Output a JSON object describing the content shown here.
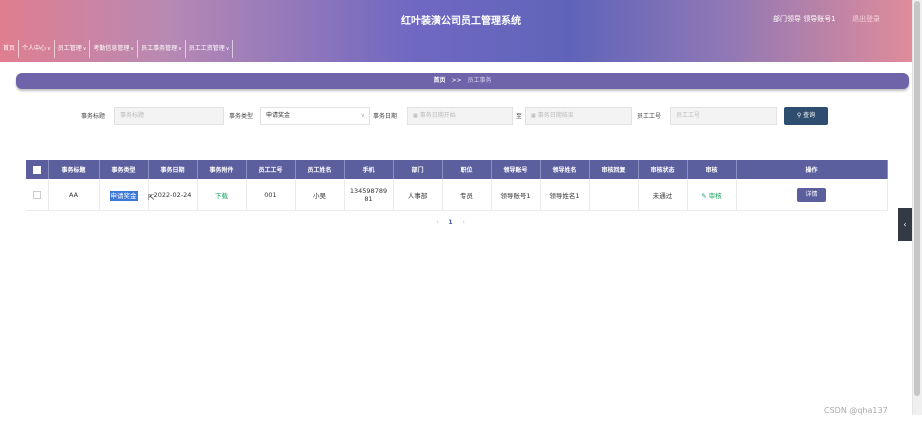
{
  "header": {
    "title": "红叶装潢公司员工管理系统",
    "user_info": "部门领导 领导账号1",
    "logout": "退出登录"
  },
  "nav": {
    "items": [
      {
        "label": "首页",
        "has_dropdown": false
      },
      {
        "label": "个人中心",
        "has_dropdown": true
      },
      {
        "label": "员工管理",
        "has_dropdown": true
      },
      {
        "label": "考勤信息管理",
        "has_dropdown": true
      },
      {
        "label": "员工事务管理",
        "has_dropdown": true
      },
      {
        "label": "员工工资管理",
        "has_dropdown": true
      }
    ]
  },
  "breadcrumb": {
    "home": "首页",
    "separator": ">>",
    "current": "员工事务"
  },
  "search": {
    "title_label": "事务标题",
    "title_placeholder": "事务标题",
    "type_label": "事务类型",
    "type_value": "申请奖金",
    "date_label": "事务日期",
    "date_start_placeholder": "事务日期开始",
    "date_to": "至",
    "date_end_placeholder": "事务日期结束",
    "empno_label": "员工工号",
    "empno_placeholder": "员工工号",
    "button": "查询"
  },
  "table": {
    "headers": [
      "事务标题",
      "事务类型",
      "事务日期",
      "事务附件",
      "员工工号",
      "员工姓名",
      "手机",
      "部门",
      "职位",
      "领导账号",
      "领导姓名",
      "审核回复",
      "审核状态",
      "审核",
      "操作"
    ],
    "rows": [
      {
        "title": "AA",
        "type": "申请奖金",
        "date": "2022-02-24",
        "attachment": "下载",
        "emp_no": "001",
        "emp_name": "小吴",
        "phone_line1": "134598789",
        "phone_line2": "81",
        "department": "人事部",
        "position": "专员",
        "leader_account": "领导账号1",
        "leader_name": "领导姓名1",
        "reply": "",
        "status": "未通过",
        "review": "审核",
        "action": "详情"
      }
    ]
  },
  "pager": {
    "prev": "‹",
    "page": "1",
    "next": "›"
  },
  "side_tab": "‹",
  "watermark": "CSDN @qha137",
  "colors": {
    "nav_gradient_mid": "#6064b9",
    "table_header": "#5c5f9e",
    "search_button": "#2f4d6e",
    "link_green": "#1aa35f"
  }
}
